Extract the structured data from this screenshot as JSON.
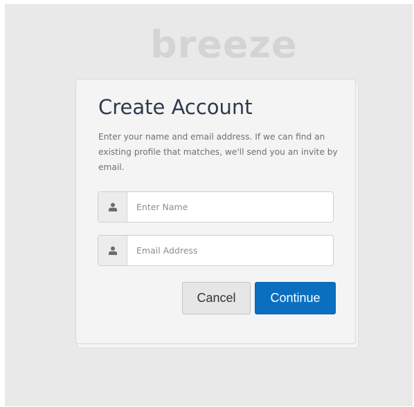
{
  "app": {
    "logo_text": "breeze"
  },
  "form": {
    "title": "Create Account",
    "description": "Enter your name and email address. If we can find an existing profile that matches, we'll send you an invite by email.",
    "name_field": {
      "value": "",
      "placeholder": "Enter Name",
      "icon": "user-icon"
    },
    "email_field": {
      "value": "",
      "placeholder": "Email Address",
      "icon": "user-icon"
    },
    "cancel_label": "Cancel",
    "continue_label": "Continue"
  },
  "colors": {
    "background": "#e9e9e9",
    "card": "#f4f4f4",
    "title": "#2d3a4b",
    "primary_button": "#0b6fc0",
    "logo": "#d4d4d4"
  }
}
